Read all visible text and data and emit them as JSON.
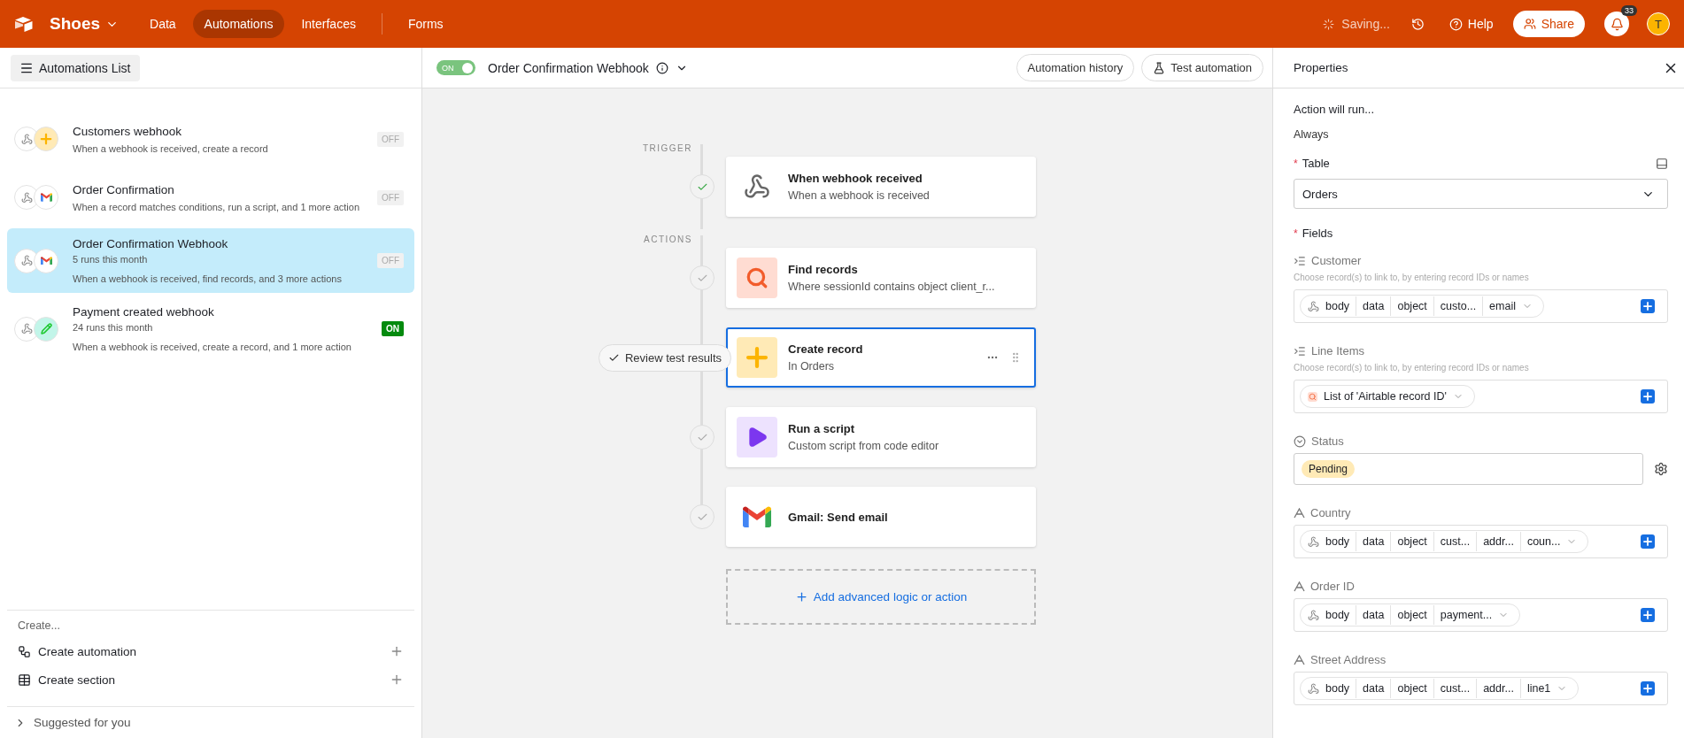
{
  "topbar": {
    "base_name": "Shoes",
    "nav": [
      {
        "label": "Data",
        "selected": false
      },
      {
        "label": "Automations",
        "selected": true
      },
      {
        "label": "Interfaces",
        "selected": false
      },
      {
        "label": "Forms",
        "selected": false
      }
    ],
    "saving": "Saving...",
    "help": "Help",
    "share": "Share",
    "notifications": "33",
    "avatar": "T"
  },
  "sidebar": {
    "header_button": "Automations List",
    "automations": [
      {
        "kind": "create-record",
        "name": "Customers webhook",
        "description": "When a webhook is received, create a record",
        "status": "OFF",
        "enabled": false,
        "selected": false
      },
      {
        "kind": "gmail",
        "name": "Order Confirmation",
        "description": "When a record matches conditions, run a script, and 1 more action",
        "status": "OFF",
        "enabled": false,
        "selected": false
      },
      {
        "kind": "gmail",
        "name": "Order Confirmation Webhook",
        "runs": "5 runs this month",
        "description": "When a webhook is received, find records, and 3 more actions",
        "status": "OFF",
        "enabled": false,
        "selected": true
      },
      {
        "kind": "update-record",
        "name": "Payment created webhook",
        "runs": "24 runs this month",
        "description": "When a webhook is received, create a record, and 1 more action",
        "status": "ON",
        "enabled": true,
        "selected": false
      }
    ],
    "create_heading": "Create...",
    "create_items": [
      {
        "label": "Create automation",
        "kind": "automation"
      },
      {
        "label": "Create section",
        "kind": "section"
      }
    ],
    "suggested": "Suggested for you"
  },
  "canvas": {
    "toggle": {
      "label": "ON",
      "on": true
    },
    "title": "Order Confirmation Webhook",
    "history_button": "Automation history",
    "test_button": "Test automation",
    "trigger_label": "TRIGGER",
    "actions_label": "ACTIONS",
    "steps": [
      {
        "kind": "webhook",
        "title": "When webhook received",
        "subtitle": "When a webhook is received",
        "tested": true,
        "selected": false
      },
      {
        "kind": "find",
        "title": "Find records",
        "subtitle": "Where sessionId contains object client_r...",
        "tested": false,
        "selected": false
      },
      {
        "kind": "create",
        "title": "Create record",
        "subtitle": "In Orders",
        "selected": true,
        "review": "Review test results"
      },
      {
        "kind": "script",
        "title": "Run a script",
        "subtitle": "Custom script from code editor",
        "tested": false,
        "selected": false
      },
      {
        "kind": "gmail",
        "title": "Gmail: Send email",
        "tested": false,
        "selected": false
      }
    ],
    "add_button": "Add advanced logic or action"
  },
  "properties": {
    "title": "Properties",
    "run_label": "Action will run...",
    "run_value": "Always",
    "table": {
      "mark": "*",
      "label": "Table",
      "value": "Orders"
    },
    "fields_mark": "*",
    "fields_label": "Fields",
    "fields": [
      {
        "kind": "link-tokens",
        "name": "Customer",
        "hint": "Choose record(s) to link to, by entering record IDs or names",
        "tokens": [
          "body",
          "data",
          "object",
          "custo...",
          "email"
        ]
      },
      {
        "kind": "link-list",
        "name": "Line Items",
        "hint": "Choose record(s) to link to, by entering record IDs or names",
        "tokens": [
          "List of 'Airtable record ID'"
        ]
      },
      {
        "kind": "select",
        "name": "Status",
        "tokens": [
          "Pending"
        ]
      },
      {
        "kind": "text-tokens",
        "name": "Country",
        "tokens": [
          "body",
          "data",
          "object",
          "cust...",
          "addr...",
          "coun..."
        ]
      },
      {
        "kind": "text-tokens",
        "name": "Order ID",
        "tokens": [
          "body",
          "data",
          "object",
          "payment..."
        ]
      },
      {
        "kind": "text-tokens",
        "name": "Street Address",
        "tokens": [
          "body",
          "data",
          "object",
          "cust...",
          "addr...",
          "line1"
        ]
      }
    ]
  }
}
